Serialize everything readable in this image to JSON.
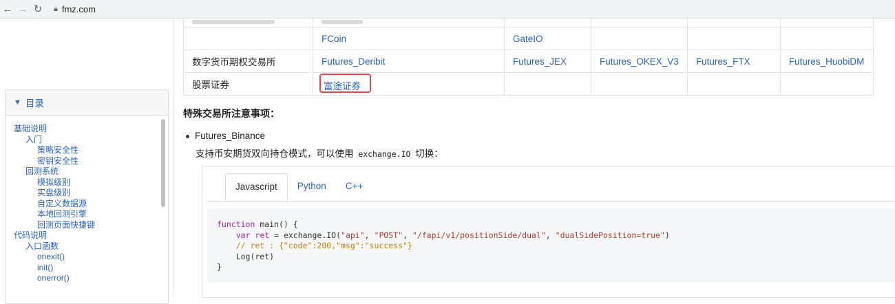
{
  "browser": {
    "url": "fmz.com"
  },
  "table": {
    "rows": [
      {
        "label": "",
        "cells": [
          "FCoin",
          "GateIO",
          "",
          "",
          ""
        ]
      },
      {
        "label": "数字货币期权交易所",
        "cells": [
          "Futures_Deribit",
          "Futures_JEX",
          "Futures_OKEX_V3",
          "Futures_FTX",
          "Futures_HuobiDM"
        ]
      },
      {
        "label": "股票证券",
        "cells": [
          "富途证券",
          "",
          "",
          "",
          ""
        ]
      }
    ]
  },
  "toc": {
    "title": "目录",
    "items": [
      {
        "label": "基础说明",
        "level": 1
      },
      {
        "label": "入门",
        "level": 2
      },
      {
        "label": "策略安全性",
        "level": 3
      },
      {
        "label": "密钥安全性",
        "level": 3
      },
      {
        "label": "回测系统",
        "level": 2
      },
      {
        "label": "模拟级别",
        "level": 3
      },
      {
        "label": "实盘级别",
        "level": 3
      },
      {
        "label": "自定义数据源",
        "level": 3
      },
      {
        "label": "本地回测引擎",
        "level": 3
      },
      {
        "label": "回测页面快捷键",
        "level": 3
      },
      {
        "label": "代码说明",
        "level": 1
      },
      {
        "label": "入口函数",
        "level": 2
      },
      {
        "label": "onexit()",
        "level": 3
      },
      {
        "label": "init()",
        "level": 3
      },
      {
        "label": "onerror()",
        "level": 3
      }
    ]
  },
  "notes": {
    "title": "特殊交易所注意事项：",
    "bullet": "Futures_Binance",
    "desc_before": "支持币安期货双向持仓模式，可以使用 ",
    "desc_code": "exchange.IO",
    "desc_after": " 切换："
  },
  "code_tabs": [
    "Javascript",
    "Python",
    "C++"
  ],
  "code_lines": {
    "l1a": "function",
    "l1b": " main() {",
    "l2a": "    var ",
    "l2b": "ret",
    "l2c": " = exchange.IO(",
    "l2s1": "\"api\"",
    "l2s2": "\"POST\"",
    "l2s3": "\"/fapi/v1/positionSide/dual\"",
    "l2s4": "\"dualSidePosition=true\"",
    "l3": "    // ret : {\"code\":200,\"msg\":\"success\"}",
    "l4": "    Log(ret)",
    "l5": "}"
  }
}
